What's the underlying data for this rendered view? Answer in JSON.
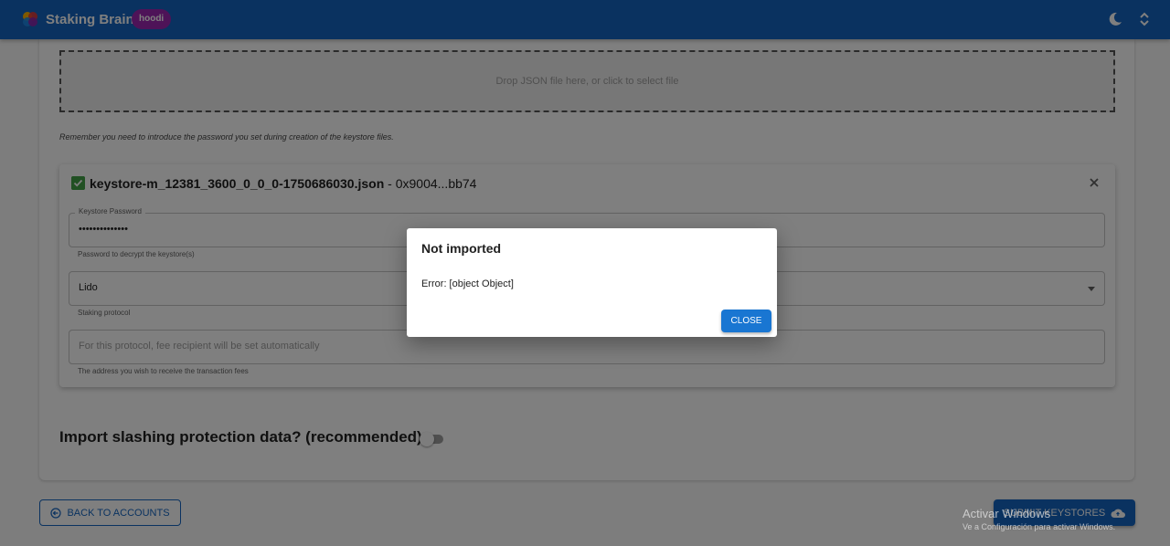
{
  "header": {
    "app_name": "Staking Brain",
    "network": "hoodi",
    "brand_color": "#1565c0",
    "icons": [
      "theme-toggle-icon",
      "expand-icon"
    ]
  },
  "dropzone": {
    "text": "Drop JSON file here, or click to select file"
  },
  "password_note": "Remember you need to introduce the password you set during creation of the keystore files.",
  "keystore": {
    "filename": "keystore-m_12381_3600_0_0_0-1750686030.json",
    "separator": " - ",
    "pubkey": "0x9004...bb74",
    "password_field": {
      "label": "Keystore Password",
      "value": "••••••••••••••",
      "help": "Password to decrypt the keystore(s)"
    },
    "protocol_field": {
      "value": "Lido",
      "help": "Staking protocol"
    },
    "fee_field": {
      "placeholder": "For this protocol, fee recipient will be set automatically",
      "help": "The address you wish to receive the transaction fees"
    }
  },
  "slashing": {
    "label": "Import slashing protection data? (recommended)",
    "enabled": false
  },
  "footer": {
    "back_label": "BACK TO ACCOUNTS",
    "submit_label": "SUBMIT KEYSTORES"
  },
  "dialog": {
    "title": "Not imported",
    "message": "Error: [object Object]",
    "close_label": "CLOSE"
  },
  "watermark": {
    "title": "Activar Windows",
    "subtitle": "Ve a Configuración para activar Windows."
  }
}
